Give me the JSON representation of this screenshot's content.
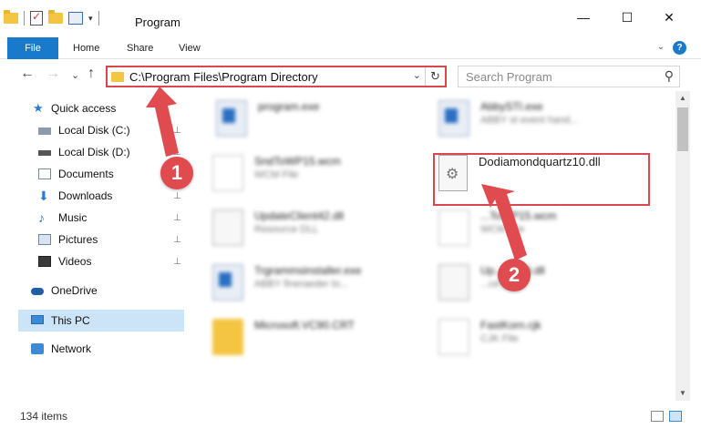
{
  "window": {
    "title": "Program",
    "minimize_glyph": "—",
    "maximize_glyph": "☐",
    "close_glyph": "✕"
  },
  "ribbon": {
    "tabs": [
      "File",
      "Home",
      "Share",
      "View"
    ],
    "help_glyph": "?",
    "collapse_glyph": "⌄"
  },
  "navbar": {
    "back_glyph": "←",
    "forward_glyph": "→",
    "recent_glyph": "⌄",
    "up_glyph": "↑",
    "address": "C:\\Program Files\\Program Directory",
    "address_dropdown_glyph": "⌄",
    "refresh_glyph": "↻",
    "search_placeholder": "Search Program",
    "search_glyph": "⚲"
  },
  "sidebar": {
    "items": [
      {
        "label": "Quick access",
        "icon": "star-icon",
        "pinned": false
      },
      {
        "label": "Local Disk (C:)",
        "icon": "drive-icon",
        "pinned": true
      },
      {
        "label": "Local Disk (D:)",
        "icon": "drive-icon",
        "pinned": true
      },
      {
        "label": "Documents",
        "icon": "documents-icon",
        "pinned": true
      },
      {
        "label": "Downloads",
        "icon": "download-icon",
        "pinned": true
      },
      {
        "label": "Music",
        "icon": "music-icon",
        "pinned": true
      },
      {
        "label": "Pictures",
        "icon": "pictures-icon",
        "pinned": true
      },
      {
        "label": "Videos",
        "icon": "videos-icon",
        "pinned": true
      },
      {
        "label": "OneDrive",
        "icon": "cloud-icon",
        "pinned": false
      },
      {
        "label": "This PC",
        "icon": "computer-icon",
        "pinned": false,
        "selected": true
      },
      {
        "label": "Network",
        "icon": "network-icon",
        "pinned": false
      }
    ],
    "pin_glyph": "📌"
  },
  "files": [
    {
      "name": "program.exe",
      "type": "",
      "icon": "exe-icon"
    },
    {
      "name": "AbbySTI.exe",
      "type": "ABBY st event hand...",
      "icon": "exe-icon"
    },
    {
      "name": "SndToWP15.wcm",
      "type": "WCM File",
      "icon": "document-icon"
    },
    {
      "name": "Dodiamondquartz10.dll",
      "type": "",
      "icon": "dll-icon",
      "highlighted": true
    },
    {
      "name": "UpdateClient42.dll",
      "type": "Resource DLL",
      "icon": "dll-icon"
    },
    {
      "name": "...ToWP15.wcm",
      "type": "WCM File",
      "icon": "document-icon"
    },
    {
      "name": "Trgrammsinstaller.exe",
      "type": "ABBY fineraeder to...",
      "icon": "exe-icon"
    },
    {
      "name": "Up...ent19.dll",
      "type": "...ce DLL",
      "icon": "dll-icon"
    },
    {
      "name": "Microsoft.VC90.CRT",
      "type": "",
      "icon": "folder-icon"
    },
    {
      "name": "FastKorn.cjk",
      "type": "CJK File",
      "icon": "document-icon"
    }
  ],
  "status": {
    "item_count": "134 items"
  },
  "callouts": [
    "1",
    "2"
  ],
  "colors": {
    "accent": "#1979ca",
    "highlight": "#d9474f",
    "callout": "#e04b4f",
    "selection": "#cce4f7"
  }
}
